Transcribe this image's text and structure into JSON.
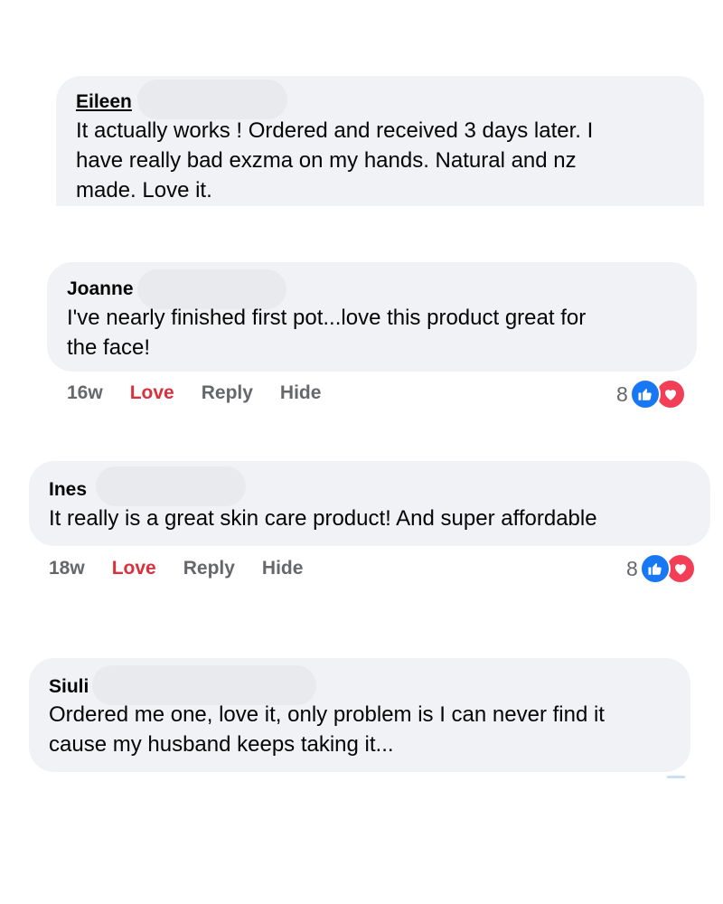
{
  "comments": [
    {
      "author": "Eileen",
      "lines": [
        "It actually works ! Ordered and received 3 days later. I",
        "have really bad exzma on my hands. Natural and nz",
        "made. Love it."
      ]
    },
    {
      "author": "Joanne",
      "lines": [
        "I've nearly finished first pot...love this product great for",
        "the face!"
      ],
      "time": "16w",
      "love_label": "Love",
      "reply_label": "Reply",
      "hide_label": "Hide",
      "reaction_count": "8"
    },
    {
      "author": "Ines",
      "lines": [
        "It really is a great skin care product! And super affordable"
      ],
      "time": "18w",
      "love_label": "Love",
      "reply_label": "Reply",
      "hide_label": "Hide",
      "reaction_count": "8"
    },
    {
      "author": "Siuli",
      "lines": [
        "Ordered me one, love it, only problem is I can never find it",
        "cause my husband keeps taking it..."
      ]
    }
  ],
  "icons": {
    "like": "like-icon",
    "heart": "heart-icon"
  },
  "colors": {
    "bubble": "#f0f2f5",
    "love": "#dc2f3c",
    "muted": "#65676b",
    "like_blue": "#1877f2",
    "heart_red": "#f33e58"
  }
}
